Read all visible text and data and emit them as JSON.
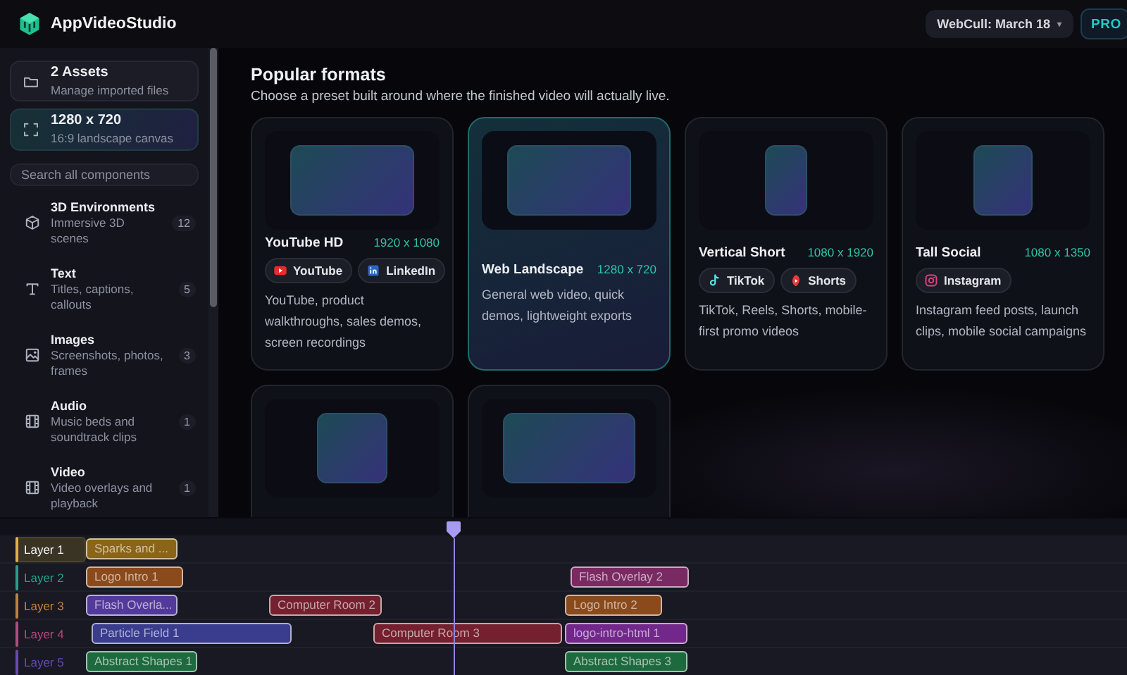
{
  "app": {
    "title": "AppVideoStudio",
    "project_menu": "WebCull: March 18",
    "project_caret": "▾",
    "plan_badge": "PRO"
  },
  "sidebar": {
    "cards": [
      {
        "kind": "folder",
        "title": "2 Assets",
        "subtitle": "Manage imported files",
        "selected": false
      },
      {
        "kind": "frame",
        "title": "1280 x 720",
        "subtitle": "16:9 landscape canvas",
        "selected": true
      }
    ],
    "search": {
      "placeholder": "Search all components"
    },
    "categories": [
      {
        "kind": "cube",
        "title": "3D Environments",
        "subtitle": "Immersive 3D scenes",
        "count": "12"
      },
      {
        "kind": "text",
        "title": "Text",
        "subtitle": "Titles, captions, callouts",
        "count": "5"
      },
      {
        "kind": "image",
        "title": "Images",
        "subtitle": "Screenshots, photos, frames",
        "count": "3"
      },
      {
        "kind": "film",
        "title": "Audio",
        "subtitle": "Music beds and soundtrack clips",
        "count": "1"
      },
      {
        "kind": "film",
        "title": "Video",
        "subtitle": "Video overlays and playback",
        "count": "1"
      }
    ]
  },
  "formats": {
    "title": "Popular formats",
    "subtitle": "Choose a preset built around where the finished video will actually live.",
    "cards": [
      {
        "kind": "landscape",
        "selected": false,
        "title": "YouTube HD",
        "resolution": "1920 x 1080",
        "chips": [
          {
            "kind": "youtube",
            "label": "YouTube"
          },
          {
            "kind": "linkedin",
            "label": "LinkedIn"
          }
        ],
        "description": "YouTube, product walkthroughs, sales demos, screen recordings"
      },
      {
        "kind": "landscape",
        "selected": true,
        "title": "Web Landscape",
        "resolution": "1280 x 720",
        "description": "General web video, quick demos, lightweight exports"
      },
      {
        "kind": "portrait",
        "selected": false,
        "title": "Vertical Short",
        "resolution": "1080 x 1920",
        "chips": [
          {
            "kind": "tiktok",
            "label": "TikTok"
          },
          {
            "kind": "shorts",
            "label": "Shorts"
          }
        ],
        "description": "TikTok, Reels, Shorts, mobile-first promo videos"
      },
      {
        "kind": "tall",
        "selected": false,
        "title": "Tall Social",
        "resolution": "1080 x 1350",
        "chips": [
          {
            "kind": "instagram",
            "label": "Instagram"
          }
        ],
        "description": "Instagram feed posts, launch clips, mobile social campaigns"
      },
      {
        "kind": "square",
        "selected": false
      },
      {
        "kind": "wide",
        "selected": false
      }
    ]
  },
  "timeline": {
    "layers": [
      {
        "label": "Layer 1",
        "color": "#e0b040",
        "selected": true,
        "clips": [
          {
            "label": "Sparks and ...",
            "color": "#8a6418"
          }
        ]
      },
      {
        "label": "Layer 2",
        "color": "#2a9d8a",
        "selected": false,
        "clips": [
          {
            "label": "Logo Intro 1",
            "color": "#8a4a1c"
          },
          {
            "label": "Flash Overlay 2",
            "color": "#7a2a62"
          }
        ]
      },
      {
        "label": "Layer 3",
        "color": "#c08040",
        "selected": false,
        "clips": [
          {
            "label": "Flash Overla...",
            "color": "#523a9a"
          },
          {
            "label": "Computer Room 2",
            "color": "#74202f"
          },
          {
            "label": "Logo Intro 2",
            "color": "#8a4a1c"
          }
        ]
      },
      {
        "label": "Layer 4",
        "color": "#b04a80",
        "selected": false,
        "clips": [
          {
            "label": "Particle Field 1",
            "color": "#3a3c8e"
          },
          {
            "label": "Computer Room 3",
            "color": "#74202f"
          },
          {
            "label": "logo-intro-html 1",
            "color": "#72288a"
          }
        ]
      },
      {
        "label": "Layer 5",
        "color": "#6a4ab0",
        "selected": false,
        "clips": [
          {
            "label": "Abstract Shapes 1",
            "color": "#1d6a3e"
          },
          {
            "label": "Abstract Shapes 3",
            "color": "#1d6a3e"
          }
        ]
      }
    ]
  }
}
